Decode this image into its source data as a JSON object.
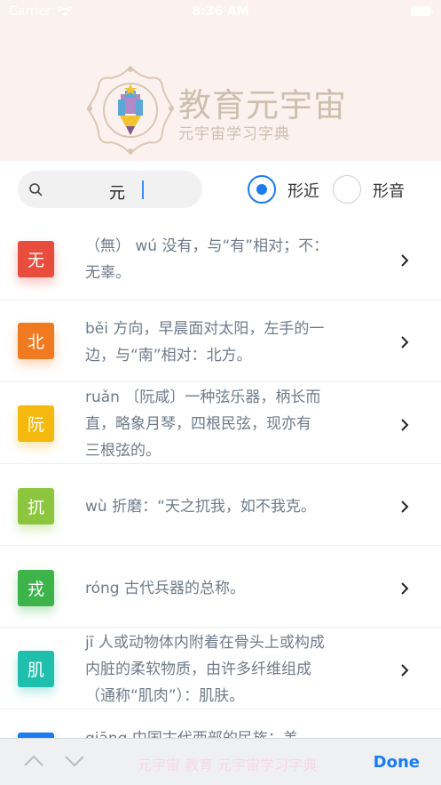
{
  "status": {
    "carrier": "Carrier",
    "time": "8:36 AM"
  },
  "brand": {
    "title": "教育元宇宙",
    "subtitle": "元宇宙学习字典"
  },
  "search": {
    "value": "元"
  },
  "options": [
    {
      "label": "形近",
      "selected": true
    },
    {
      "label": "形音",
      "selected": false
    }
  ],
  "results": [
    {
      "char": "无",
      "color": "#e84c3d",
      "line1": "（無） wú 没有，与“有”相对；不：",
      "line2": "无辜。",
      "line3": ""
    },
    {
      "char": "北",
      "color": "#f07a1f",
      "line1": "běi 方向，早晨面对太阳，左手的一",
      "line2": "边，与“南”相对：北方。",
      "line3": ""
    },
    {
      "char": "阮",
      "color": "#f5b80e",
      "line1": "ruǎn 〔阮咸〕一种弦乐器，柄长而",
      "line2": "直，略象月琴，四根民弦，现亦有",
      "line3": "三根弦的。"
    },
    {
      "char": "扤",
      "color": "#8cc63e",
      "line1": "wù 折磨：“天之扤我，如不我克。",
      "line2": "",
      "line3": ""
    },
    {
      "char": "戎",
      "color": "#3cb44a",
      "line1": "róng 古代兵器的总称。",
      "line2": "",
      "line3": ""
    },
    {
      "char": "肌",
      "color": "#1fbfae",
      "line1": "jī 人或动物体内附着在骨头上或构成",
      "line2": "内脏的柔软物质，由许多纤维组成",
      "line3": "（通称“肌肉”）：肌肤。"
    }
  ],
  "partial_row": {
    "color": "#1a7cf0",
    "text": "qiāng 中国古代西部的民族：羌"
  },
  "toolbar": {
    "done": "Done",
    "faint": "元宇宙 教育 元宇宙学习字典"
  }
}
